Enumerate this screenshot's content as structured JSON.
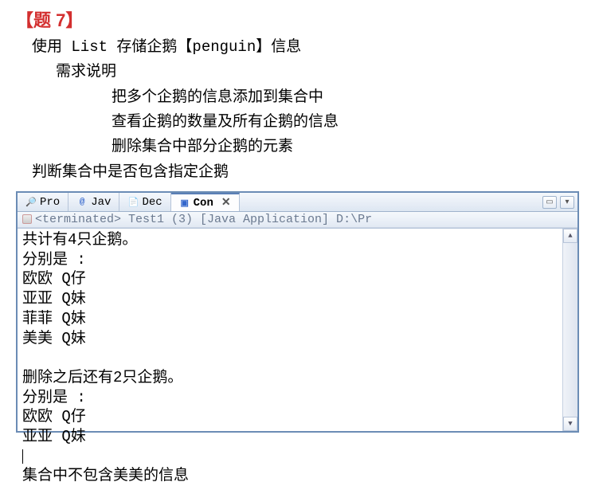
{
  "problem": {
    "title": "【题 7】",
    "lines": [
      "使用 List 存储企鹅【penguin】信息",
      "需求说明",
      "把多个企鹅的信息添加到集合中",
      "查看企鹅的数量及所有企鹅的信息",
      "删除集合中部分企鹅的元素",
      "判断集合中是否包含指定企鹅"
    ]
  },
  "ide": {
    "tabs": [
      {
        "label": "Pro",
        "icon": "🔎"
      },
      {
        "label": "Jav",
        "icon": "@"
      },
      {
        "label": "Dec",
        "icon": "📄"
      },
      {
        "label": "Con",
        "icon": "▣",
        "active": true
      }
    ],
    "close_x": "✕",
    "status": "<terminated> Test1 (3) [Java Application] D:\\Pr",
    "console_lines": [
      "共计有4只企鹅。",
      "分别是 :",
      "欧欧 Q仔",
      "亚亚 Q妹",
      "菲菲 Q妹",
      "美美 Q妹",
      "",
      "删除之后还有2只企鹅。",
      "分别是 :",
      "欧欧 Q仔",
      "亚亚 Q妹"
    ],
    "final_line": "集合中不包含美美的信息",
    "scroll": {
      "up": "▲",
      "down": "▼"
    }
  }
}
